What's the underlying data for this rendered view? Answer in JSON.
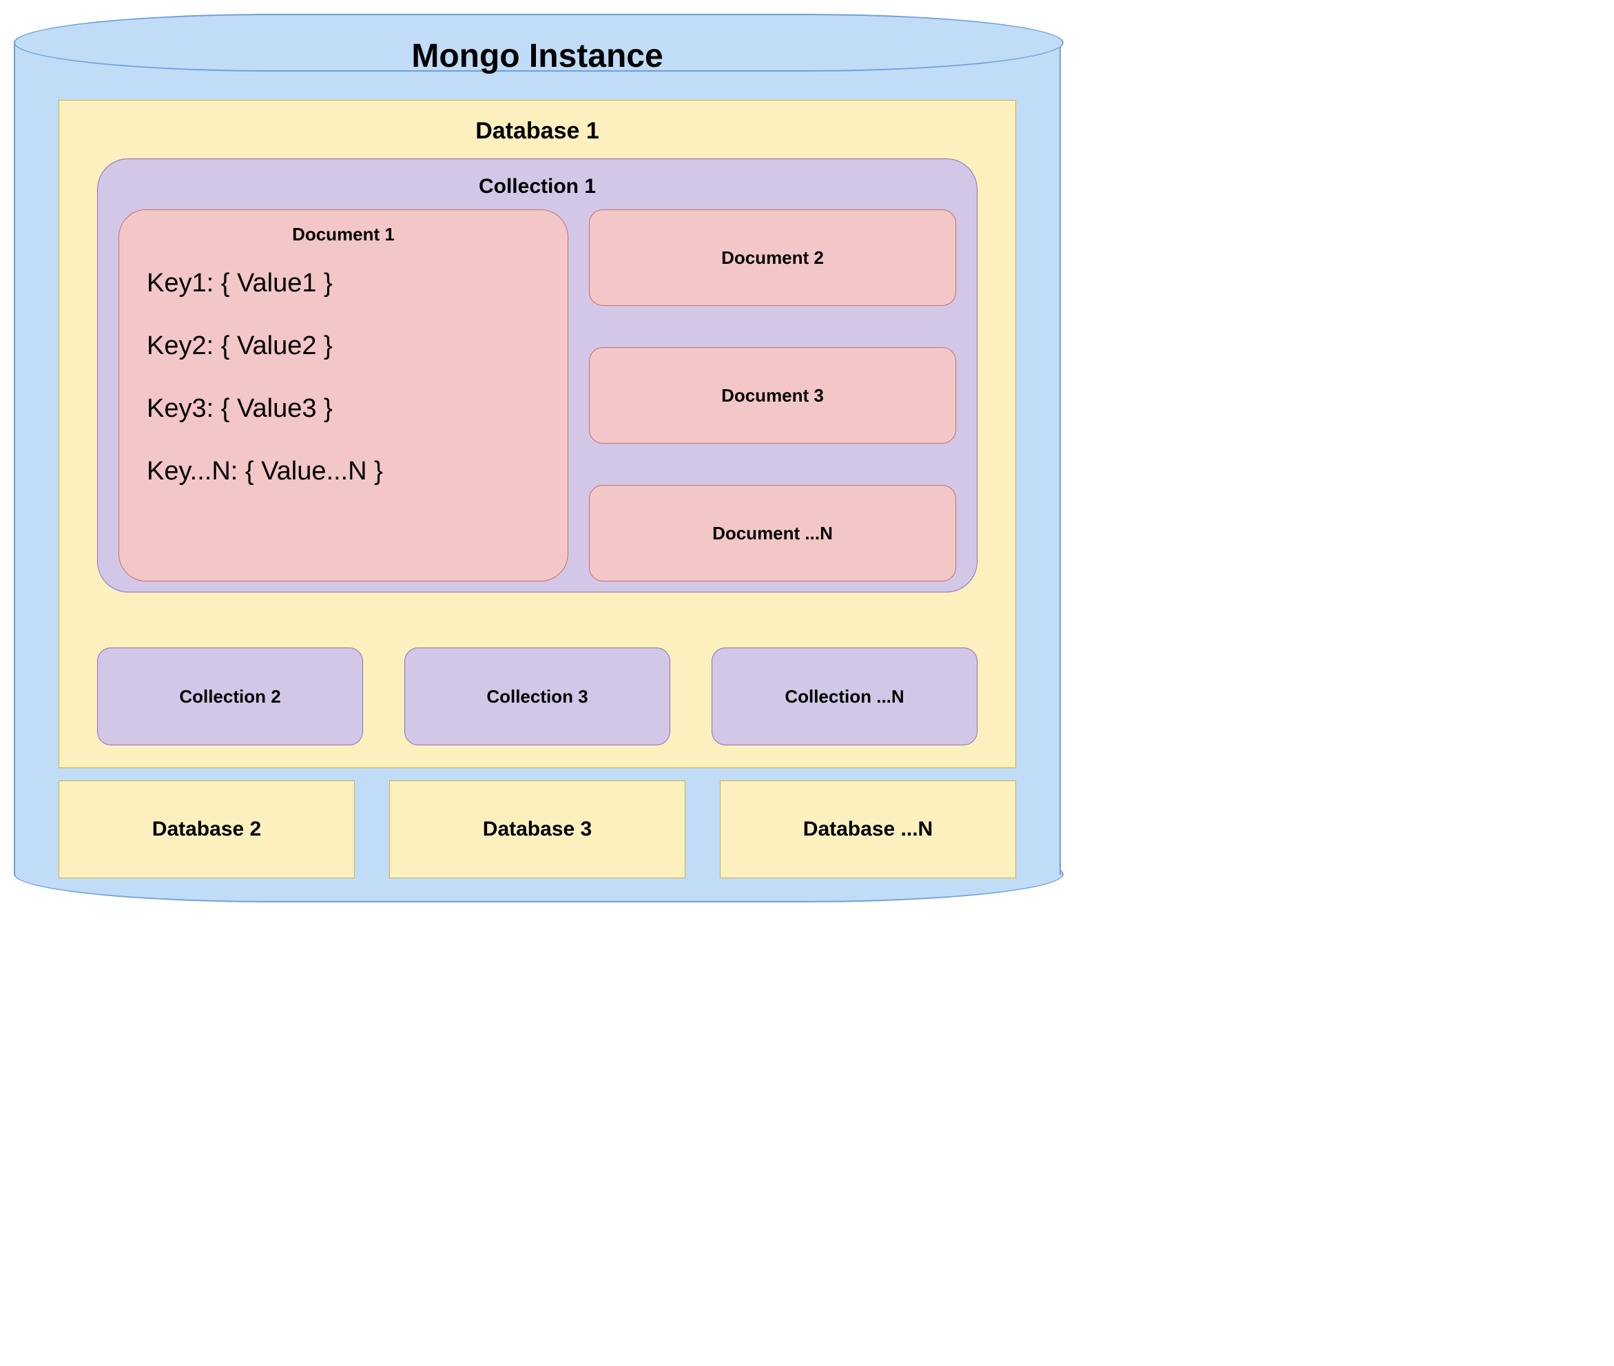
{
  "instance": {
    "title": "Mongo Instance"
  },
  "databases": [
    {
      "name": "Database 1",
      "collections": [
        {
          "name": "Collection 1",
          "documents": [
            {
              "name": "Document 1",
              "pairs": [
                "Key1: { Value1 }",
                "Key2: { Value2 }",
                "Key3: { Value3 }",
                "Key...N: { Value...N }"
              ]
            },
            {
              "name": "Document 2"
            },
            {
              "name": "Document 3"
            },
            {
              "name": "Document ...N"
            }
          ]
        },
        {
          "name": "Collection 2"
        },
        {
          "name": "Collection 3"
        },
        {
          "name": "Collection ...N"
        }
      ]
    },
    {
      "name": "Database 2"
    },
    {
      "name": "Database 3"
    },
    {
      "name": "Database ...N"
    }
  ]
}
